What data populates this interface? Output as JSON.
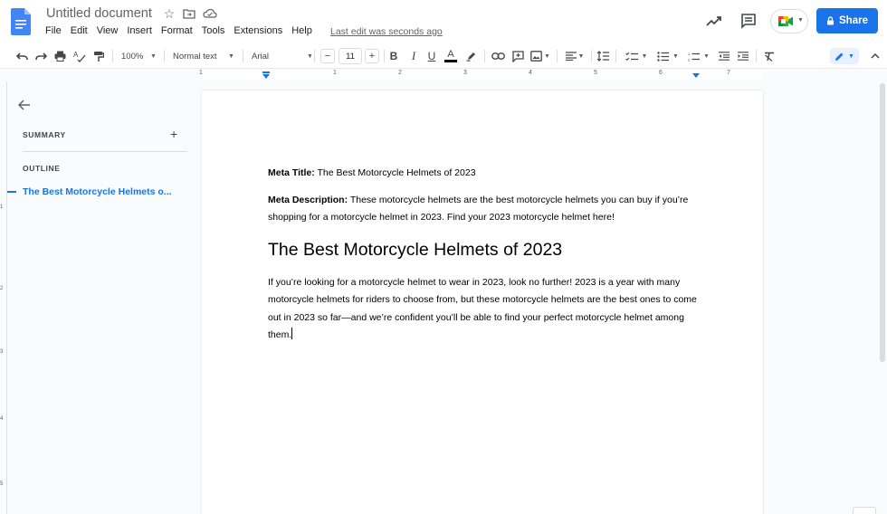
{
  "app": {
    "doc_title": "Untitled document",
    "menus": [
      "File",
      "Edit",
      "View",
      "Insert",
      "Format",
      "Tools",
      "Extensions",
      "Help"
    ],
    "last_edit": "Last edit was seconds ago",
    "share_label": "Share",
    "brand_color": "#1a73e8"
  },
  "toolbar": {
    "zoom": "100%",
    "style": "Normal text",
    "font": "Arial",
    "font_size": "11",
    "minus": "−",
    "plus": "+",
    "bold": "B",
    "italic": "I",
    "underline": "U",
    "text_color": "A"
  },
  "ruler": {
    "numbers": [
      "1",
      "1",
      "2",
      "3",
      "4",
      "5",
      "6",
      "7"
    ]
  },
  "vruler": {
    "numbers": [
      "1",
      "2",
      "3",
      "4",
      "5"
    ]
  },
  "sidebar": {
    "summary_label": "SUMMARY",
    "add_label": "+",
    "outline_label": "OUTLINE",
    "outline_items": [
      "The Best Motorcycle Helmets o..."
    ]
  },
  "document": {
    "meta_title_label": "Meta Title:",
    "meta_title": " The Best Motorcycle Helmets of 2023",
    "meta_description_label": "Meta Description:",
    "meta_description": " These motorcycle helmets are the best motorcycle helmets you can buy if you’re shopping for a motorcycle helmet in 2023. Find your 2023 motorcycle helmet here!",
    "heading": "The Best Motorcycle Helmets of 2023",
    "body": "If you’re looking for a motorcycle helmet to wear in 2023, look no further! 2023 is a year with many motorcycle helmets for riders to choose from, but these motorcycle helmets are the best ones to come out in 2023 so far—and we’re confident you’ll be able to find your perfect motorcycle helmet among them."
  }
}
